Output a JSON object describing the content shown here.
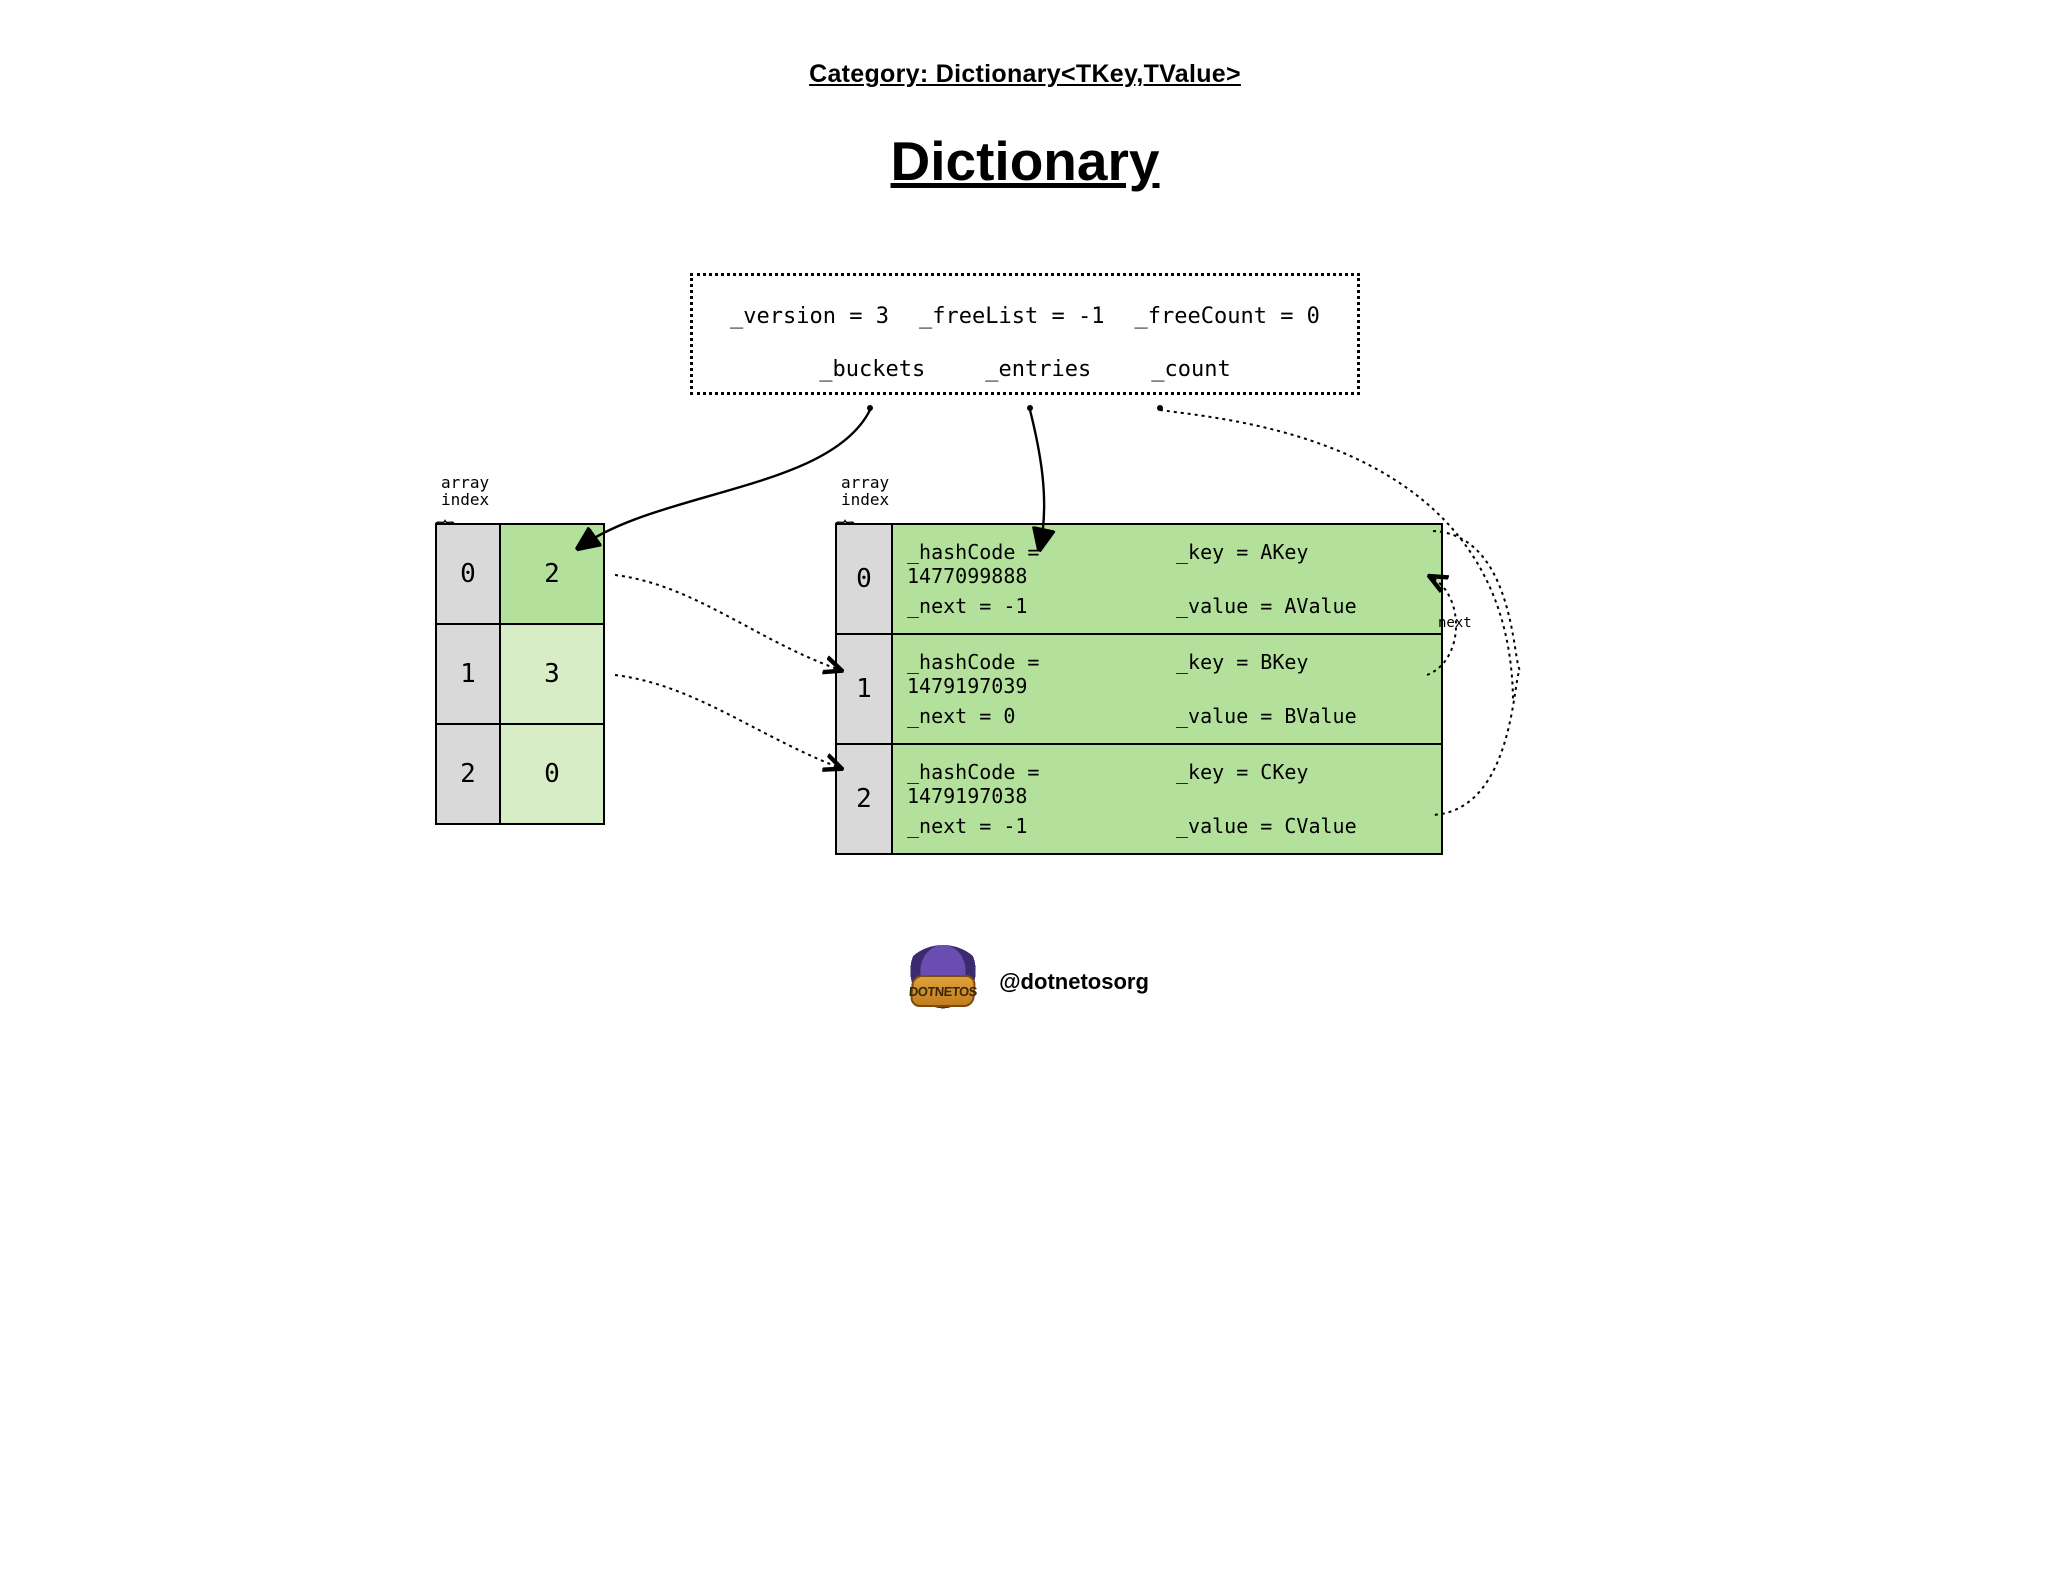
{
  "header": {
    "category_line": "Category: Dictionary<TKey,TValue>",
    "title": "Dictionary"
  },
  "dictionary_object": {
    "version_text": "_version = 3",
    "freelist_text": "_freeList = -1",
    "freecount_text": "_freeCount = 0",
    "buckets_label": "_buckets",
    "entries_label": "_entries",
    "count_label": "_count"
  },
  "labels": {
    "array_index": "array\nindex",
    "next": "next"
  },
  "buckets": [
    {
      "index": "0",
      "value": "2",
      "highlight": true
    },
    {
      "index": "1",
      "value": "3",
      "highlight": false
    },
    {
      "index": "2",
      "value": "0",
      "highlight": false
    }
  ],
  "entries": [
    {
      "index": "0",
      "hash": "_hashCode = 1477099888",
      "next": "_next = -1",
      "key": "_key = AKey",
      "value": "_value = AValue"
    },
    {
      "index": "1",
      "hash": "_hashCode = 1479197039",
      "next": "_next = 0",
      "key": "_key = BKey",
      "value": "_value = BValue"
    },
    {
      "index": "2",
      "hash": "_hashCode = 1479197038",
      "next": "_next = -1",
      "key": "_key = CKey",
      "value": "_value = CValue"
    }
  ],
  "footer": {
    "handle": "@dotnetosorg",
    "logo_text": "DOTNETOS"
  }
}
